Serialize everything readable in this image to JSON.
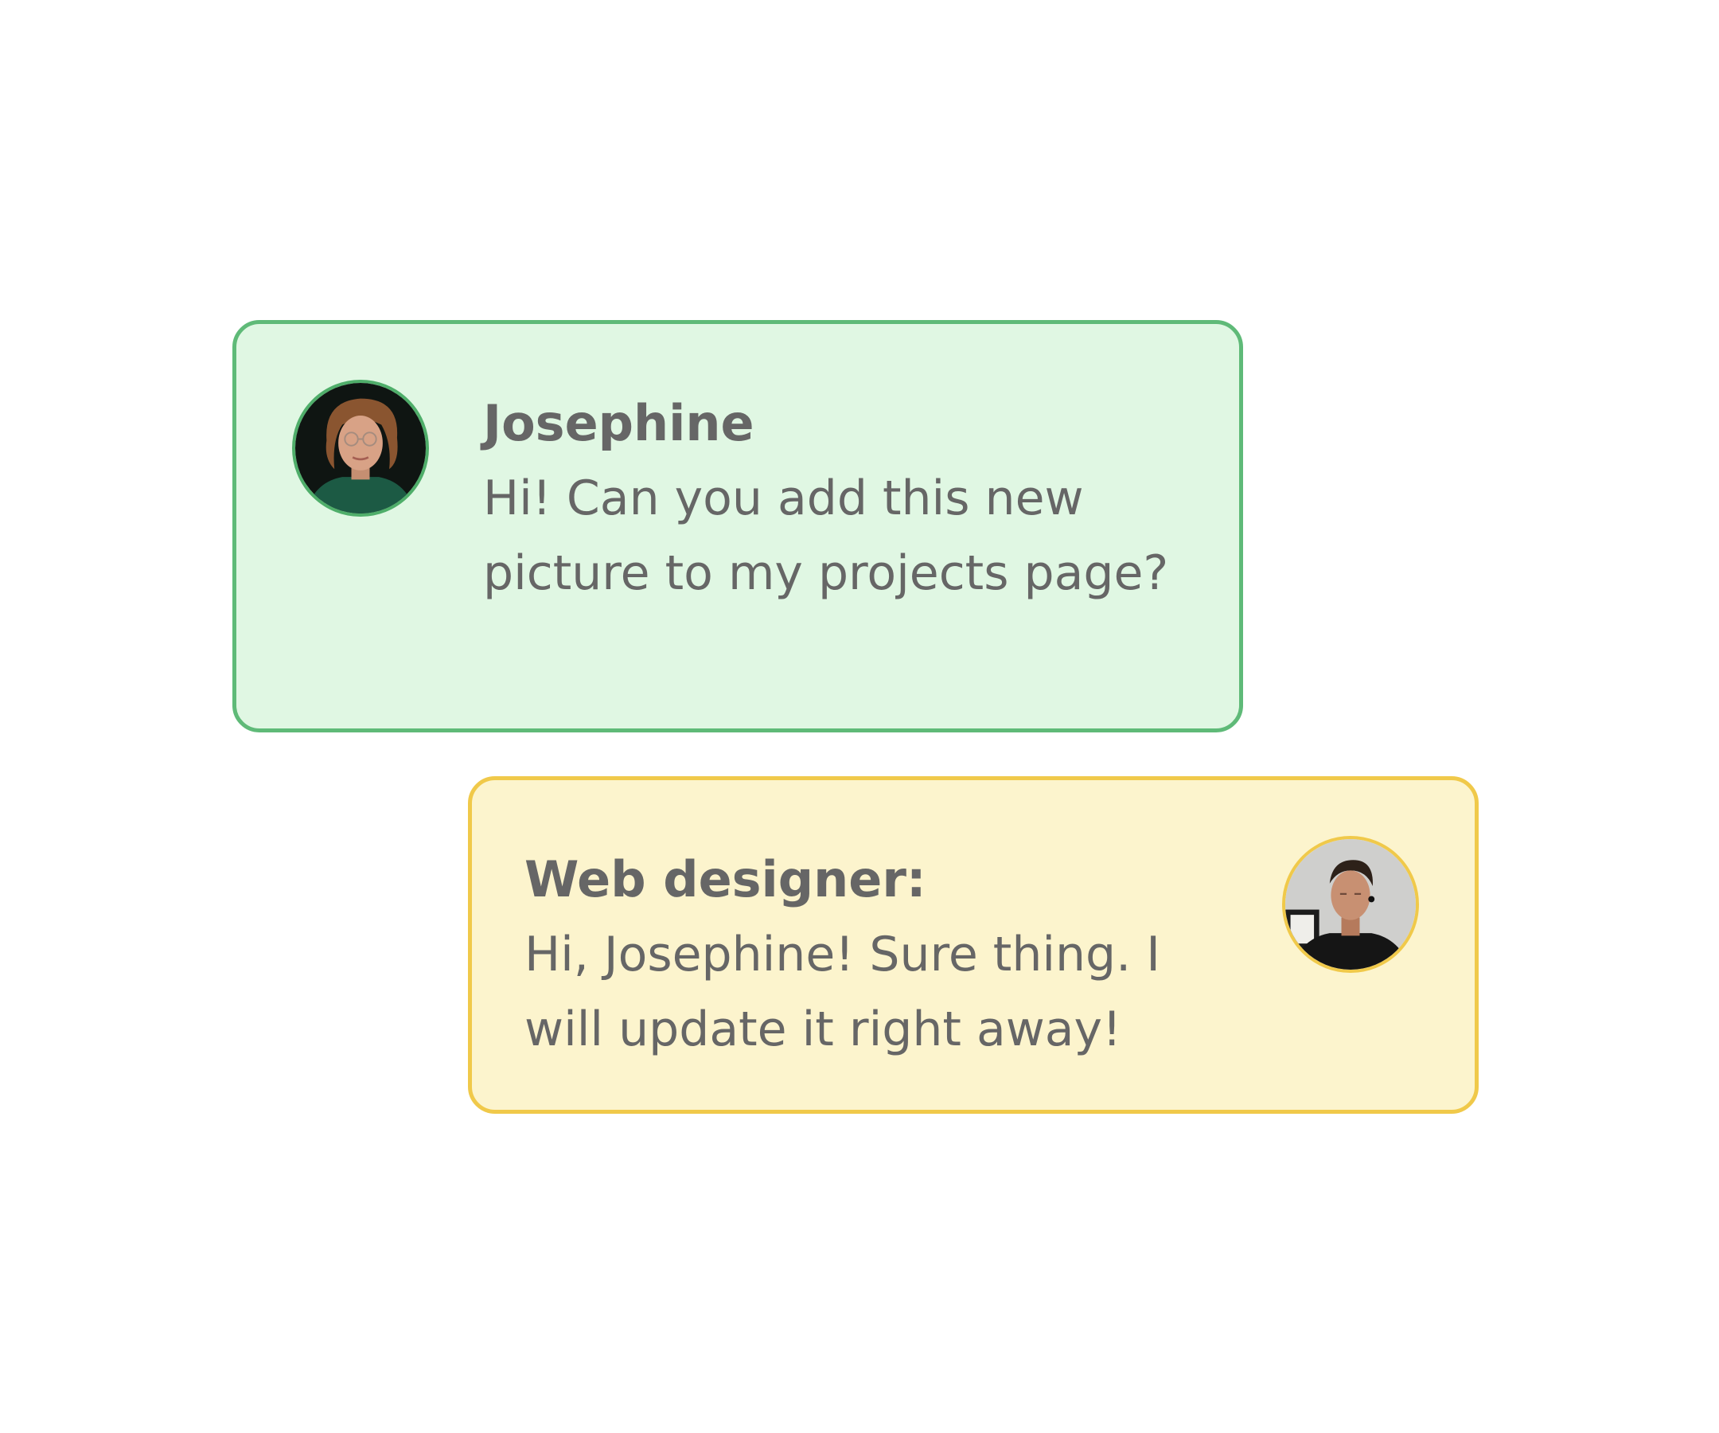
{
  "colors": {
    "background": "#ffffff",
    "josephine_bubble_fill": "#e0f7e3",
    "josephine_bubble_border": "#5fba78",
    "designer_bubble_fill": "#fcf4cd",
    "designer_bubble_border": "#f0c94a",
    "text": "#666666"
  },
  "messages": [
    {
      "sender": "Josephine",
      "text": "Hi! Can you add this new picture to my projects page?",
      "avatar_icon": "woman-avatar-photo"
    },
    {
      "sender": "Web designer:",
      "text": "Hi, Josephine! Sure thing. I will update it right away!",
      "avatar_icon": "man-avatar-photo"
    }
  ]
}
